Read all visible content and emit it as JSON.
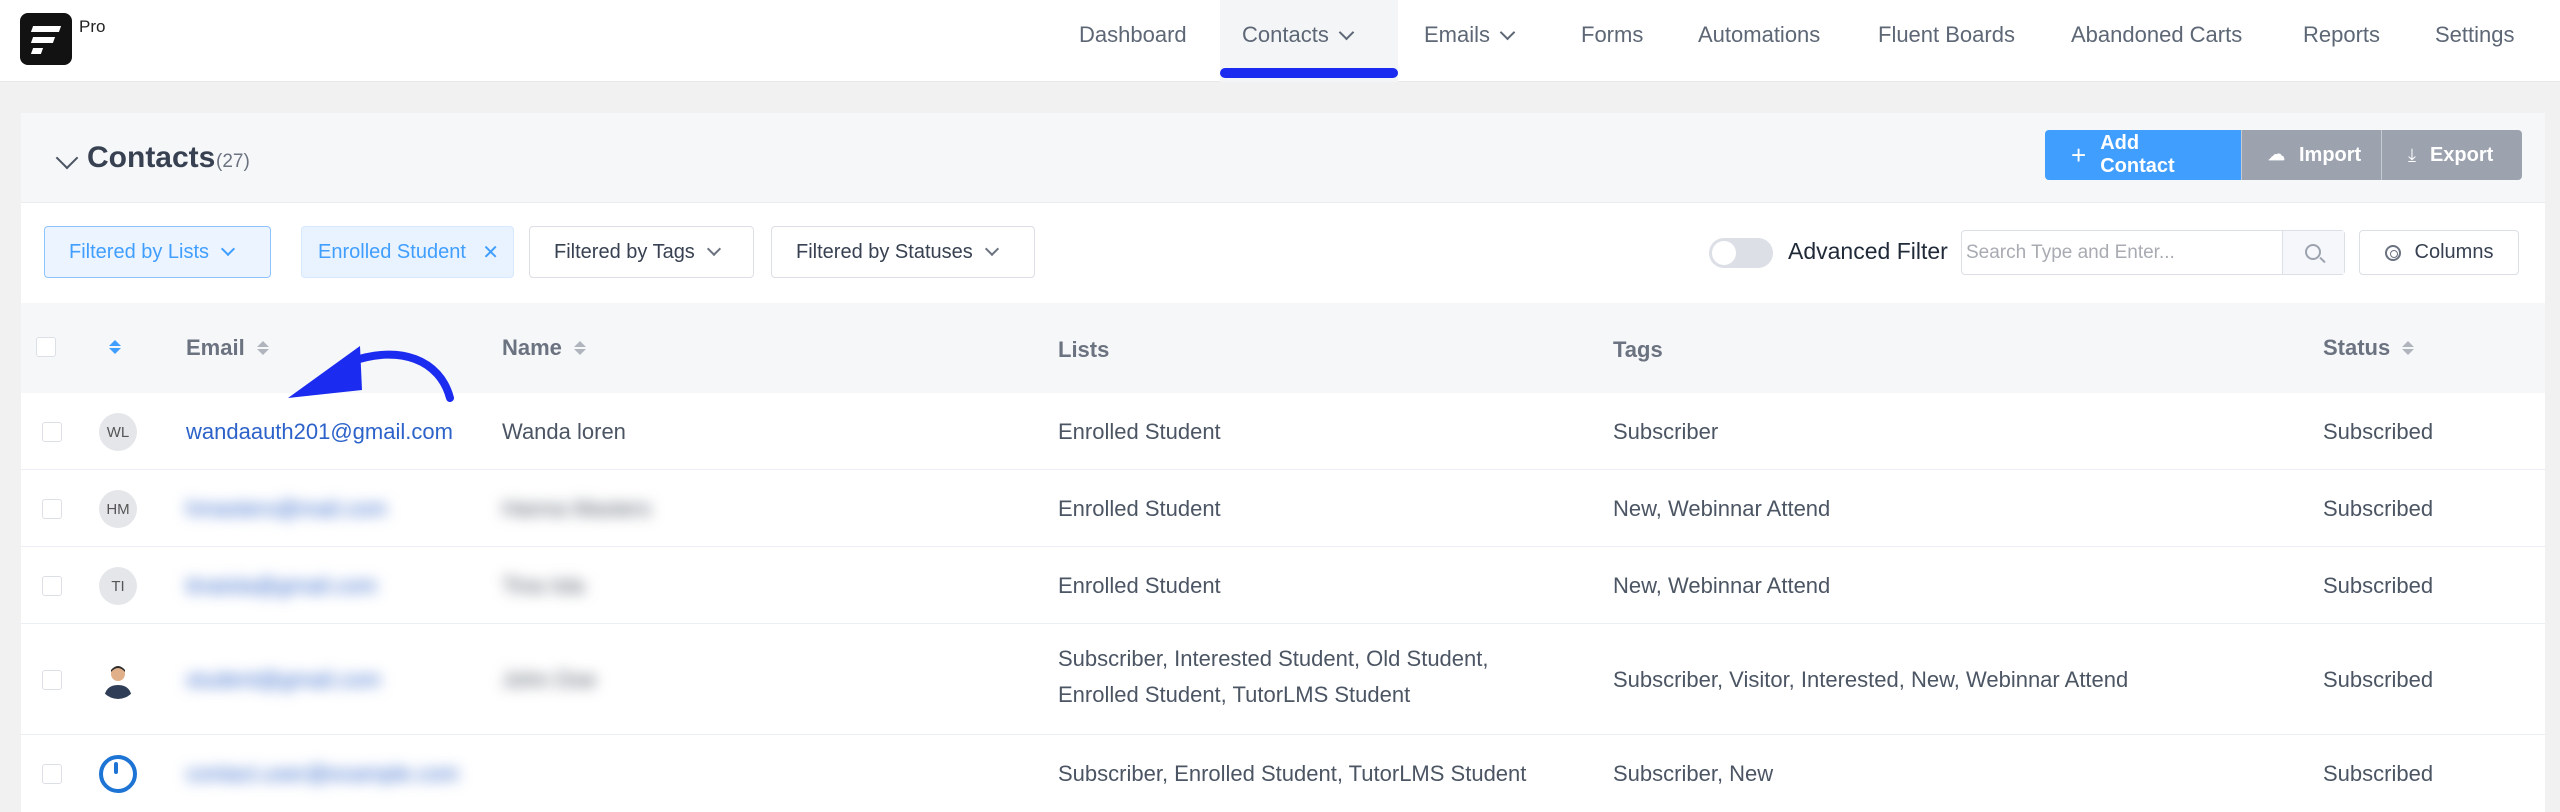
{
  "app": {
    "badge": "Pro"
  },
  "nav": {
    "items": [
      {
        "label": "Dashboard",
        "has_dropdown": false
      },
      {
        "label": "Contacts",
        "has_dropdown": true,
        "active": true
      },
      {
        "label": "Emails",
        "has_dropdown": true
      },
      {
        "label": "Forms",
        "has_dropdown": false
      },
      {
        "label": "Automations",
        "has_dropdown": false
      },
      {
        "label": "Fluent Boards",
        "has_dropdown": false
      },
      {
        "label": "Abandoned Carts",
        "has_dropdown": false
      },
      {
        "label": "Reports",
        "has_dropdown": false
      },
      {
        "label": "Settings",
        "has_dropdown": false
      }
    ],
    "active_underline_color": "#1c2bf0"
  },
  "header": {
    "title": "Contacts",
    "count": "(27)",
    "buttons": {
      "add": "Add Contact",
      "import": "Import",
      "export": "Export"
    }
  },
  "filters": {
    "lists": "Filtered by Lists",
    "selected_chip": "Enrolled Student",
    "tags": "Filtered by Tags",
    "statuses": "Filtered by Statuses",
    "advanced_filter": "Advanced Filter",
    "advanced_enabled": false,
    "search_placeholder": "Search Type and Enter...",
    "columns": "Columns"
  },
  "table": {
    "columns": {
      "email": "Email",
      "name": "Name",
      "lists": "Lists",
      "tags": "Tags",
      "status": "Status"
    },
    "rows": [
      {
        "initials": "WL",
        "email": "wandaauth201@gmail.com",
        "name": "Wanda loren",
        "lists": "Enrolled Student",
        "tags": "Subscriber",
        "status": "Subscribed",
        "blurred": false
      },
      {
        "initials": "HM",
        "email": "hmasters@mail.com",
        "name": "Hanna Masters",
        "lists": "Enrolled Student",
        "tags": "New, Webinnar Attend",
        "status": "Subscribed",
        "blurred": true
      },
      {
        "initials": "TI",
        "email": "tinaisla@gmail.com",
        "name": "Tina Isla",
        "lists": "Enrolled Student",
        "tags": "New, Webinnar Attend",
        "status": "Subscribed",
        "blurred": true
      },
      {
        "initials": "",
        "email": "student@gmail.com",
        "name": "John Doe",
        "lists": "Subscriber, Interested Student, Old Student,",
        "lists_line2": "Enrolled Student, TutorLMS Student",
        "tags": "Subscriber, Visitor, Interested, New, Webinnar Attend",
        "status": "Subscribed",
        "blurred": true,
        "avatar": "photo"
      },
      {
        "initials": "",
        "email": "contact.user@example.com",
        "name": "",
        "lists": "Subscriber, Enrolled Student, TutorLMS Student",
        "tags": "Subscriber, New",
        "status": "Subscribed",
        "blurred": true,
        "avatar": "ring"
      }
    ]
  },
  "colors": {
    "primary": "#409eff",
    "secondary_button": "#9ca3af",
    "annotation_arrow": "#1c2bf0",
    "link": "#2c62c9"
  }
}
